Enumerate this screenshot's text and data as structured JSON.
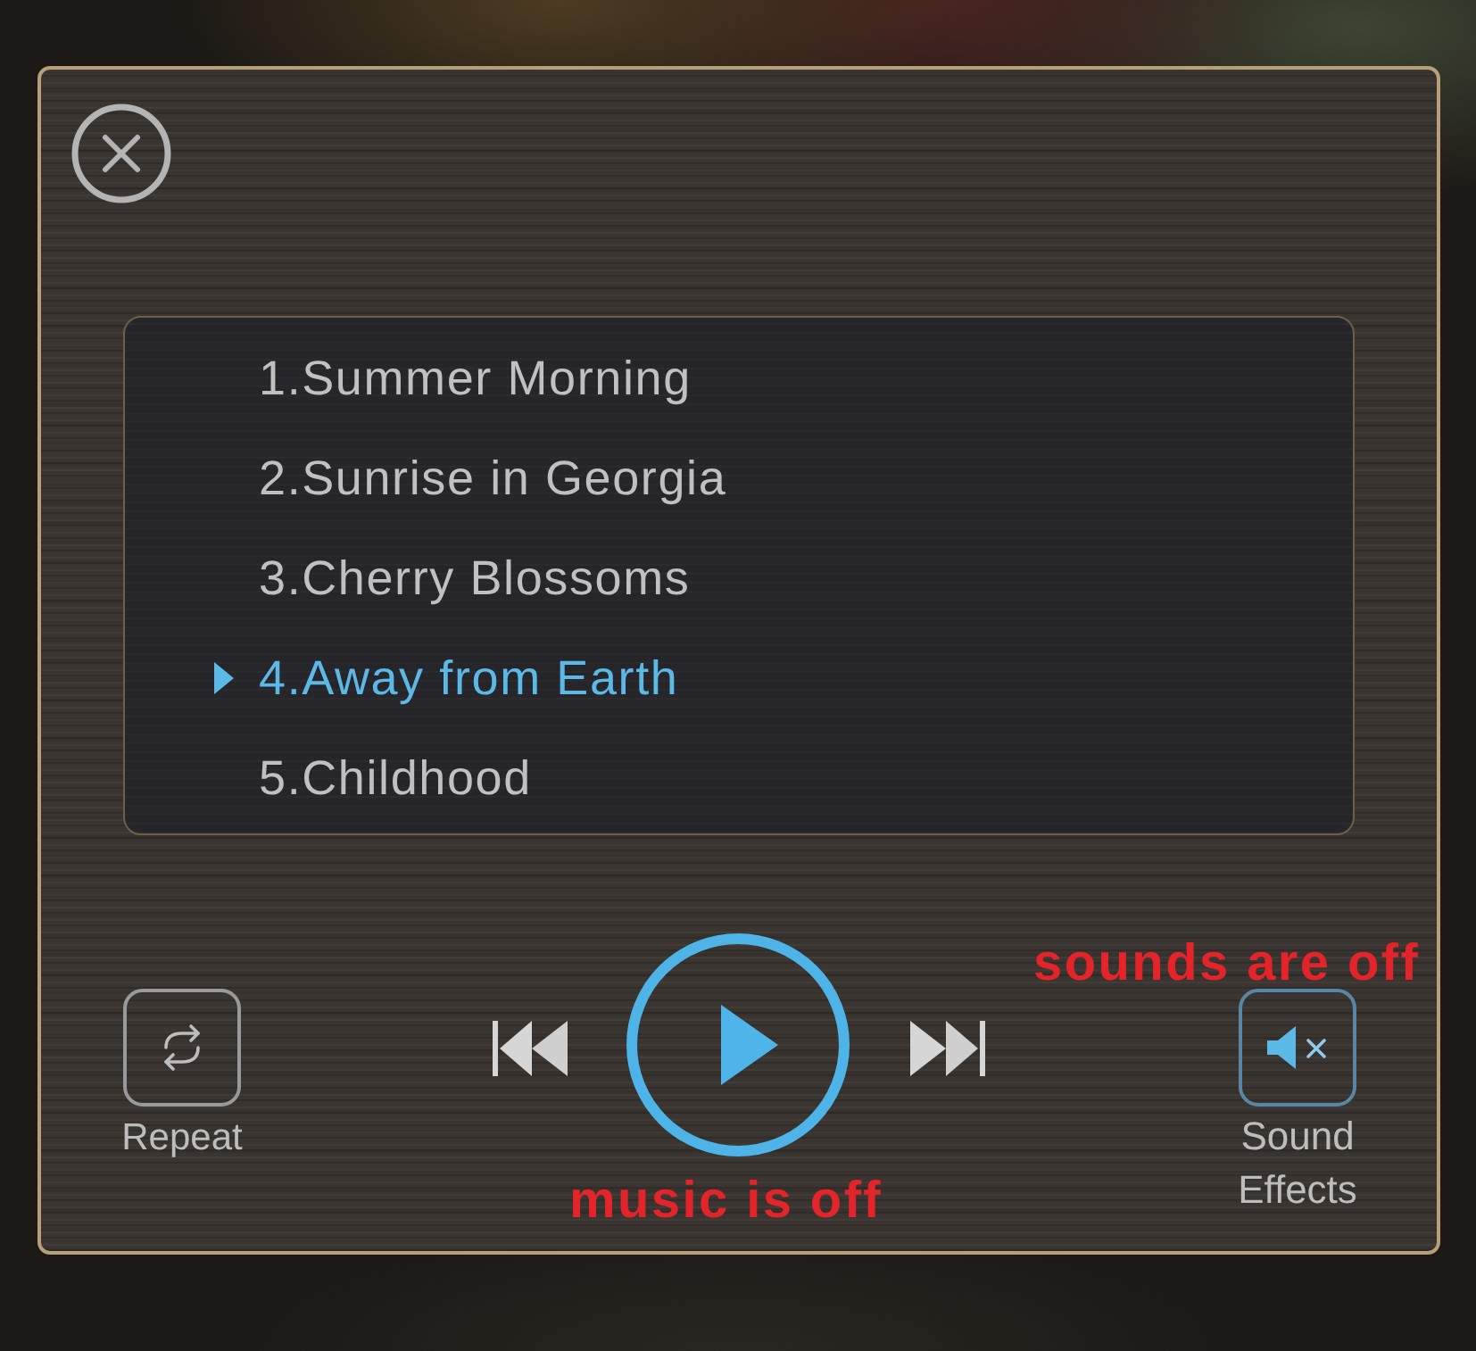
{
  "playlist": {
    "tracks": [
      {
        "title": "1.Summer Morning",
        "selected": false
      },
      {
        "title": "2.Sunrise in Georgia",
        "selected": false
      },
      {
        "title": "3.Cherry Blossoms",
        "selected": false
      },
      {
        "title": "4.Away from Earth",
        "selected": true
      },
      {
        "title": "5.Childhood",
        "selected": false
      }
    ]
  },
  "controls": {
    "repeat": {
      "label": "Repeat",
      "on": false
    },
    "play": {
      "playing": false
    },
    "sound_effects": {
      "label": "Sound Effects",
      "muted": true
    }
  },
  "annotations": [
    {
      "text": "sounds are off",
      "kind": "sounds"
    },
    {
      "text": "music is off",
      "kind": "music"
    }
  ]
}
